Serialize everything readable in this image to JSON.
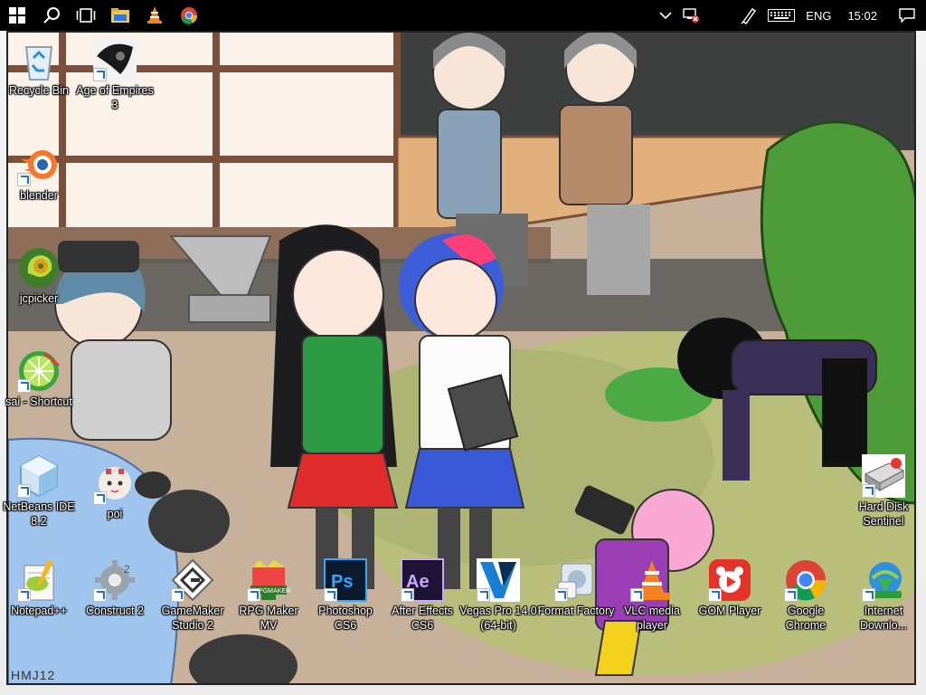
{
  "taskbar": {
    "icons": [
      "windows-start-icon",
      "search-icon",
      "task-view-icon",
      "file-explorer-icon",
      "vlc-icon",
      "chrome-icon"
    ],
    "language": "ENG",
    "time": "15:02"
  },
  "desktop_icons": [
    {
      "label": "Recycle Bin",
      "icon": "recycle-bin-icon"
    },
    {
      "label": "Age of Empires 3",
      "icon": "age-of-empires-icon"
    },
    {
      "label": "blender",
      "icon": "blender-icon"
    },
    {
      "label": "jcpicker",
      "icon": "jcpicker-icon"
    },
    {
      "label": "sai - Shortcut",
      "icon": "sai-icon"
    },
    {
      "label": "NetBeans IDE 8.2",
      "icon": "netbeans-icon"
    },
    {
      "label": "poi",
      "icon": "poi-icon"
    },
    {
      "label": "Hard Disk Sentinel",
      "icon": "hard-disk-sentinel-icon"
    },
    {
      "label": "Notepad++",
      "icon": "notepadpp-icon"
    },
    {
      "label": "Construct 2",
      "icon": "construct2-icon"
    },
    {
      "label": "GameMaker Studio 2",
      "icon": "gamemaker-icon"
    },
    {
      "label": "RPG Maker MV",
      "icon": "rpgmaker-icon"
    },
    {
      "label": "Photoshop CS6",
      "icon": "photoshop-icon"
    },
    {
      "label": "After Effects CS6",
      "icon": "after-effects-icon"
    },
    {
      "label": "Vegas Pro 14.0 (64-bit)",
      "icon": "vegas-pro-icon"
    },
    {
      "label": "Format Factory",
      "icon": "format-factory-icon"
    },
    {
      "label": "VLC media player",
      "icon": "vlc-icon"
    },
    {
      "label": "GOM Player",
      "icon": "gom-player-icon"
    },
    {
      "label": "Google Chrome",
      "icon": "chrome-icon"
    },
    {
      "label": "Internet Downlo...",
      "icon": "internet-download-manager-icon"
    }
  ],
  "wallpaper": {
    "signature": "HMJ12"
  }
}
